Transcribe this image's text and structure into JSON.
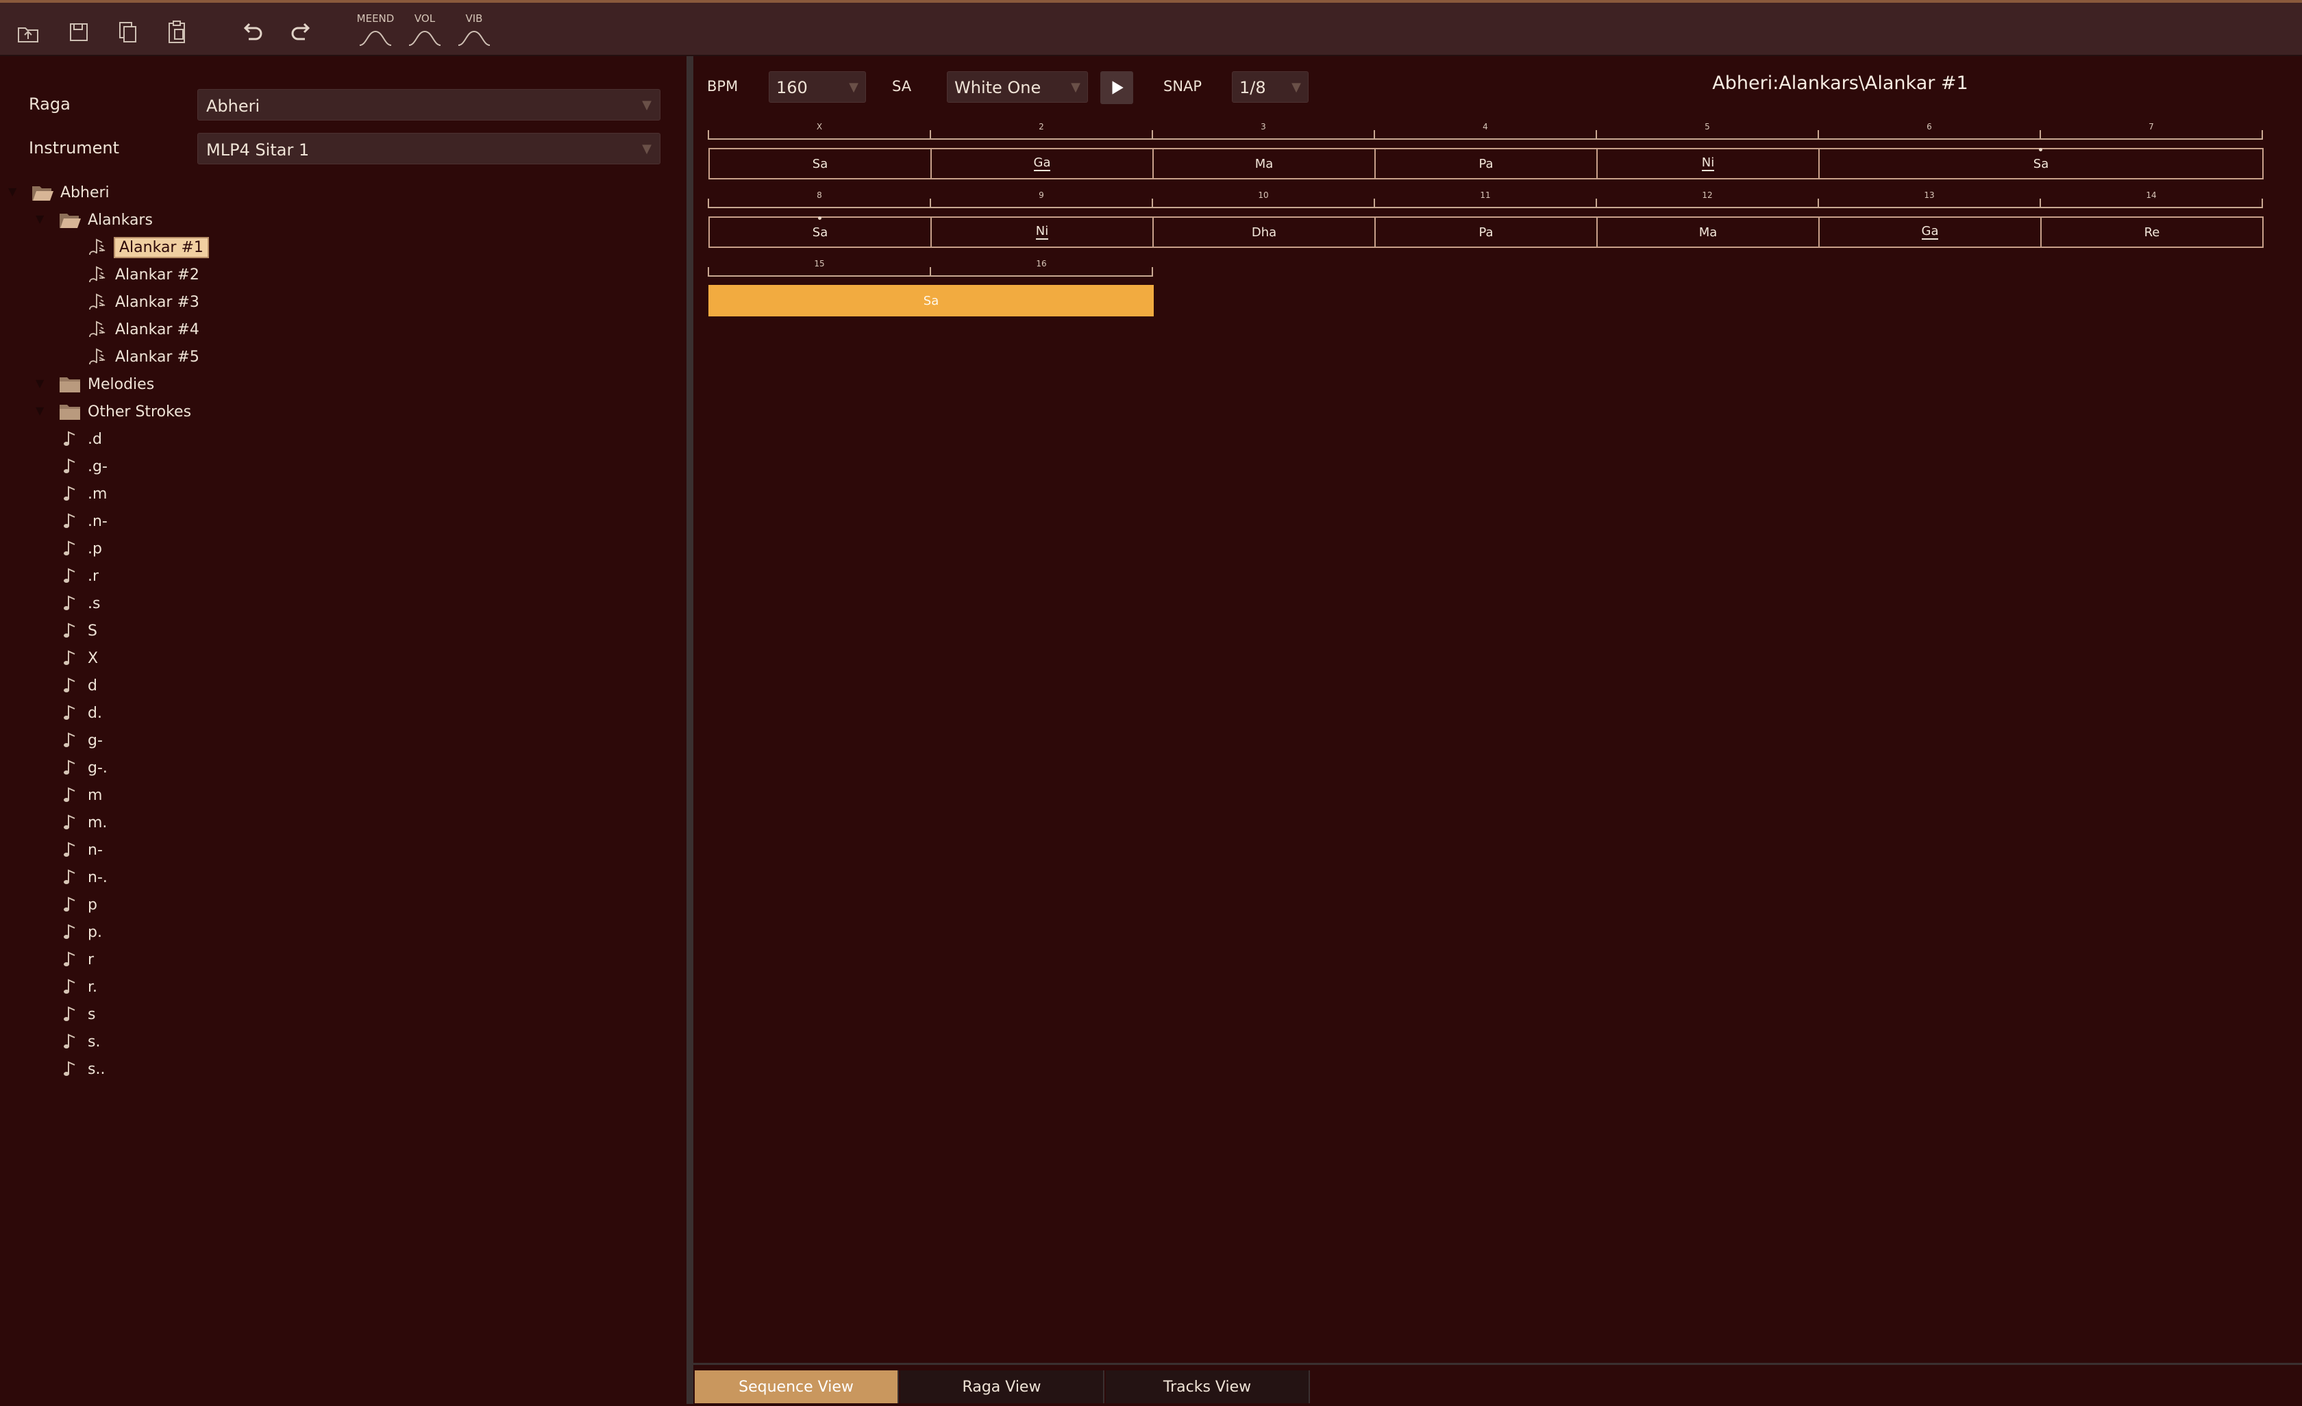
{
  "toolbar": {
    "buttons": [
      {
        "name": "upload-icon"
      },
      {
        "name": "save-icon"
      },
      {
        "name": "copy-icon"
      },
      {
        "name": "paste-icon"
      },
      {
        "name": "undo-icon"
      },
      {
        "name": "redo-icon"
      }
    ],
    "fx": [
      {
        "label": "MEEND"
      },
      {
        "label": "VOL"
      },
      {
        "label": "VIB"
      }
    ]
  },
  "left": {
    "raga_label": "Raga",
    "raga_value": "Abheri",
    "instrument_label": "Instrument",
    "instrument_value": "MLP4 Sitar 1",
    "tree": {
      "root": "Abheri",
      "alankars_folder": "Alankars",
      "alankars": [
        "Alankar #1",
        "Alankar #2",
        "Alankar #3",
        "Alankar #4",
        "Alankar #5"
      ],
      "melodies_folder": "Melodies",
      "other_strokes_folder": "Other Strokes",
      "strokes": [
        ".d",
        ".g-",
        ".m",
        ".n-",
        ".p",
        ".r",
        ".s",
        "S",
        "X",
        "d",
        "d.",
        "g-",
        "g-.",
        "m",
        "m.",
        "n-",
        "n-.",
        "p",
        "p.",
        "r",
        "r.",
        "s",
        "s.",
        "s.."
      ]
    }
  },
  "right": {
    "bpm_label": "BPM",
    "bpm_value": "160",
    "sa_label": "SA",
    "sa_value": "White One",
    "snap_label": "SNAP",
    "snap_value": "1/8",
    "title": "Abheri:Alankars\\Alankar #1",
    "rows": [
      {
        "ticks": [
          "X",
          "2",
          "3",
          "4",
          "5",
          "6",
          "7"
        ],
        "notes": [
          {
            "label": "Sa"
          },
          {
            "label": "Ga",
            "underline": true
          },
          {
            "label": "Ma"
          },
          {
            "label": "Pa"
          },
          {
            "label": "Ni",
            "underline": true
          },
          {
            "label": "Sa",
            "top_dot": true,
            "span": 2
          }
        ]
      },
      {
        "ticks": [
          "8",
          "9",
          "10",
          "11",
          "12",
          "13",
          "14"
        ],
        "notes": [
          {
            "label": "Sa",
            "top_dot": true
          },
          {
            "label": "Ni",
            "underline": true
          },
          {
            "label": "Dha"
          },
          {
            "label": "Pa"
          },
          {
            "label": "Ma"
          },
          {
            "label": "Ga",
            "underline": true
          },
          {
            "label": "Re"
          }
        ]
      },
      {
        "ticks": [
          "15",
          "16"
        ],
        "notes": [
          {
            "label": "Sa",
            "active": true,
            "span": 2
          }
        ]
      }
    ]
  },
  "tabs": [
    "Sequence View",
    "Raga View",
    "Tracks View"
  ],
  "active_tab": "Sequence View",
  "colors": {
    "background": "#2d0909",
    "accent": "#f2ab40",
    "tab_active": "#c9975e"
  }
}
